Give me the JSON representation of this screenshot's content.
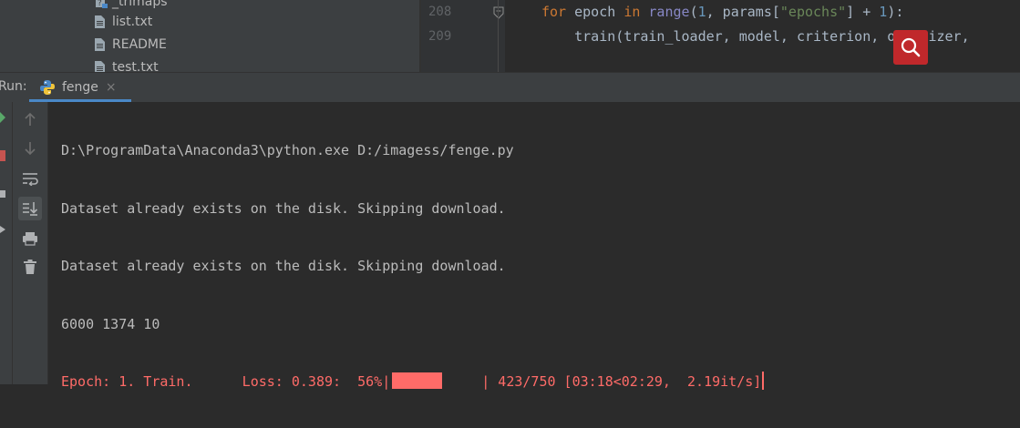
{
  "project_tree": {
    "items": [
      {
        "label": "_trimaps",
        "icon": "unknown-file-icon"
      },
      {
        "label": "list.txt",
        "icon": "text-file-icon"
      },
      {
        "label": "README",
        "icon": "text-file-icon"
      },
      {
        "label": "test.txt",
        "icon": "text-file-icon"
      }
    ]
  },
  "editor": {
    "lines": [
      {
        "number": "208",
        "tokens": [
          {
            "t": "for",
            "c": "kw"
          },
          {
            "t": " epoch ",
            "c": ""
          },
          {
            "t": "in",
            "c": "kw"
          },
          {
            "t": " ",
            "c": ""
          },
          {
            "t": "range",
            "c": "bi"
          },
          {
            "t": "(",
            "c": ""
          },
          {
            "t": "1",
            "c": "num"
          },
          {
            "t": ", params[",
            "c": ""
          },
          {
            "t": "\"epochs\"",
            "c": "str"
          },
          {
            "t": "] + ",
            "c": ""
          },
          {
            "t": "1",
            "c": "num"
          },
          {
            "t": "):",
            "c": ""
          }
        ]
      },
      {
        "number": "209",
        "tokens": [
          {
            "t": "    train(train_loader, model, criterion, optimizer, ",
            "c": ""
          }
        ]
      }
    ]
  },
  "run_panel": {
    "label": "Run:",
    "tab": {
      "title": "fenge",
      "icon": "python-icon",
      "close": "×"
    },
    "toolbar": [
      {
        "name": "up-arrow-icon"
      },
      {
        "name": "down-arrow-icon"
      },
      {
        "name": "soft-wrap-icon"
      },
      {
        "name": "scroll-to-end-icon"
      },
      {
        "name": "print-icon"
      },
      {
        "name": "trash-icon"
      }
    ],
    "console": {
      "lines": [
        "D:\\ProgramData\\Anaconda3\\python.exe D:/imagess/fenge.py",
        "Dataset already exists on the disk. Skipping download.",
        "Dataset already exists on the disk. Skipping download.",
        "6000 1374 10"
      ],
      "progress": {
        "prefix": "Epoch: 1. Train.      Loss: 0.389:  56%|",
        "percent": 56,
        "suffix": "| 423/750 [03:18<02:29,  2.19it/s]",
        "color": "#ff6b68"
      }
    }
  },
  "colors": {
    "accent": "#4a88c7",
    "search_button": "#c0282b",
    "error_text": "#ff6b68"
  }
}
